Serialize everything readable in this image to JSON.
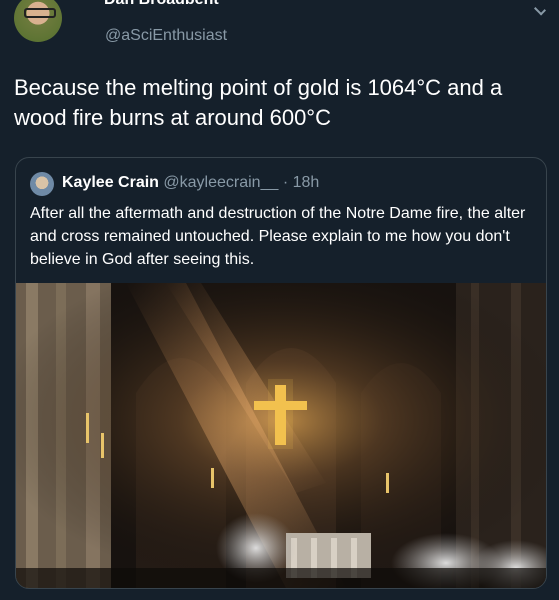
{
  "author": {
    "name": "Dan Broadbent",
    "handle": "@aSciEnthusiast"
  },
  "tweet": {
    "text": "Because the melting point of gold is 1064°C and a wood fire burns at around 600°C"
  },
  "quoted": {
    "name": "Kaylee Crain",
    "handle": "@kayleecrain__",
    "separator": "·",
    "time": "18h",
    "text": "After all the aftermath and destruction of the Notre Dame fire, the alter and cross remained untouched. Please explain to me how you don't believe in God after seeing this."
  },
  "icons": {
    "menu": "chevron-down-icon"
  },
  "colors": {
    "background": "#15202b",
    "secondary_text": "#8899a6",
    "border": "#38444d"
  }
}
